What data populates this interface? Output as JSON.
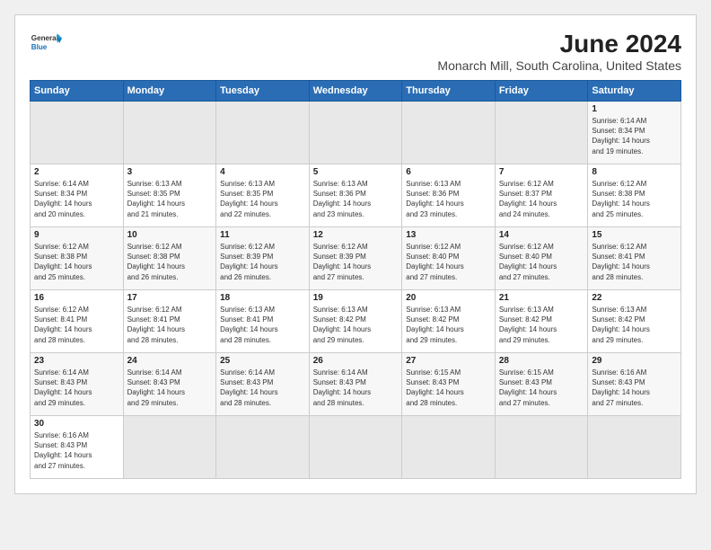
{
  "logo": {
    "line1": "General",
    "line2": "Blue"
  },
  "title": "June 2024",
  "subtitle": "Monarch Mill, South Carolina, United States",
  "weekdays": [
    "Sunday",
    "Monday",
    "Tuesday",
    "Wednesday",
    "Thursday",
    "Friday",
    "Saturday"
  ],
  "weeks": [
    [
      {
        "day": "",
        "info": ""
      },
      {
        "day": "",
        "info": ""
      },
      {
        "day": "",
        "info": ""
      },
      {
        "day": "",
        "info": ""
      },
      {
        "day": "",
        "info": ""
      },
      {
        "day": "",
        "info": ""
      },
      {
        "day": "1",
        "info": "Sunrise: 6:14 AM\nSunset: 8:34 PM\nDaylight: 14 hours\nand 19 minutes."
      }
    ],
    [
      {
        "day": "2",
        "info": "Sunrise: 6:14 AM\nSunset: 8:34 PM\nDaylight: 14 hours\nand 20 minutes."
      },
      {
        "day": "3",
        "info": "Sunrise: 6:13 AM\nSunset: 8:35 PM\nDaylight: 14 hours\nand 21 minutes."
      },
      {
        "day": "4",
        "info": "Sunrise: 6:13 AM\nSunset: 8:35 PM\nDaylight: 14 hours\nand 22 minutes."
      },
      {
        "day": "5",
        "info": "Sunrise: 6:13 AM\nSunset: 8:36 PM\nDaylight: 14 hours\nand 23 minutes."
      },
      {
        "day": "6",
        "info": "Sunrise: 6:13 AM\nSunset: 8:36 PM\nDaylight: 14 hours\nand 23 minutes."
      },
      {
        "day": "7",
        "info": "Sunrise: 6:12 AM\nSunset: 8:37 PM\nDaylight: 14 hours\nand 24 minutes."
      },
      {
        "day": "8",
        "info": "Sunrise: 6:12 AM\nSunset: 8:38 PM\nDaylight: 14 hours\nand 25 minutes."
      }
    ],
    [
      {
        "day": "9",
        "info": "Sunrise: 6:12 AM\nSunset: 8:38 PM\nDaylight: 14 hours\nand 25 minutes."
      },
      {
        "day": "10",
        "info": "Sunrise: 6:12 AM\nSunset: 8:38 PM\nDaylight: 14 hours\nand 26 minutes."
      },
      {
        "day": "11",
        "info": "Sunrise: 6:12 AM\nSunset: 8:39 PM\nDaylight: 14 hours\nand 26 minutes."
      },
      {
        "day": "12",
        "info": "Sunrise: 6:12 AM\nSunset: 8:39 PM\nDaylight: 14 hours\nand 27 minutes."
      },
      {
        "day": "13",
        "info": "Sunrise: 6:12 AM\nSunset: 8:40 PM\nDaylight: 14 hours\nand 27 minutes."
      },
      {
        "day": "14",
        "info": "Sunrise: 6:12 AM\nSunset: 8:40 PM\nDaylight: 14 hours\nand 27 minutes."
      },
      {
        "day": "15",
        "info": "Sunrise: 6:12 AM\nSunset: 8:41 PM\nDaylight: 14 hours\nand 28 minutes."
      }
    ],
    [
      {
        "day": "16",
        "info": "Sunrise: 6:12 AM\nSunset: 8:41 PM\nDaylight: 14 hours\nand 28 minutes."
      },
      {
        "day": "17",
        "info": "Sunrise: 6:12 AM\nSunset: 8:41 PM\nDaylight: 14 hours\nand 28 minutes."
      },
      {
        "day": "18",
        "info": "Sunrise: 6:13 AM\nSunset: 8:41 PM\nDaylight: 14 hours\nand 28 minutes."
      },
      {
        "day": "19",
        "info": "Sunrise: 6:13 AM\nSunset: 8:42 PM\nDaylight: 14 hours\nand 29 minutes."
      },
      {
        "day": "20",
        "info": "Sunrise: 6:13 AM\nSunset: 8:42 PM\nDaylight: 14 hours\nand 29 minutes."
      },
      {
        "day": "21",
        "info": "Sunrise: 6:13 AM\nSunset: 8:42 PM\nDaylight: 14 hours\nand 29 minutes."
      },
      {
        "day": "22",
        "info": "Sunrise: 6:13 AM\nSunset: 8:42 PM\nDaylight: 14 hours\nand 29 minutes."
      }
    ],
    [
      {
        "day": "23",
        "info": "Sunrise: 6:14 AM\nSunset: 8:43 PM\nDaylight: 14 hours\nand 29 minutes."
      },
      {
        "day": "24",
        "info": "Sunrise: 6:14 AM\nSunset: 8:43 PM\nDaylight: 14 hours\nand 29 minutes."
      },
      {
        "day": "25",
        "info": "Sunrise: 6:14 AM\nSunset: 8:43 PM\nDaylight: 14 hours\nand 28 minutes."
      },
      {
        "day": "26",
        "info": "Sunrise: 6:14 AM\nSunset: 8:43 PM\nDaylight: 14 hours\nand 28 minutes."
      },
      {
        "day": "27",
        "info": "Sunrise: 6:15 AM\nSunset: 8:43 PM\nDaylight: 14 hours\nand 28 minutes."
      },
      {
        "day": "28",
        "info": "Sunrise: 6:15 AM\nSunset: 8:43 PM\nDaylight: 14 hours\nand 27 minutes."
      },
      {
        "day": "29",
        "info": "Sunrise: 6:16 AM\nSunset: 8:43 PM\nDaylight: 14 hours\nand 27 minutes."
      }
    ],
    [
      {
        "day": "30",
        "info": "Sunrise: 6:16 AM\nSunset: 8:43 PM\nDaylight: 14 hours\nand 27 minutes."
      },
      {
        "day": "",
        "info": ""
      },
      {
        "day": "",
        "info": ""
      },
      {
        "day": "",
        "info": ""
      },
      {
        "day": "",
        "info": ""
      },
      {
        "day": "",
        "info": ""
      },
      {
        "day": "",
        "info": ""
      }
    ]
  ]
}
